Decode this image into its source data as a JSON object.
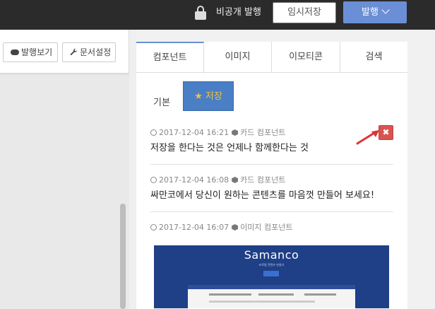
{
  "topbar": {
    "private_label": "비공개 발행",
    "draft_label": "임시저장",
    "publish_label": "발행",
    "lock_icon": "lock-icon",
    "chevron_icon": "chevron-down-icon"
  },
  "left": {
    "preview_label": "발행보기",
    "settings_label": "문서설정",
    "preview_icon": "cloud-icon",
    "settings_icon": "wrench-icon"
  },
  "tabs": [
    {
      "label": "컴포넌트",
      "active": true
    },
    {
      "label": "이미지",
      "active": false
    },
    {
      "label": "이모티콘",
      "active": false
    },
    {
      "label": "검색",
      "active": false
    }
  ],
  "subtabs": {
    "basic_label": "기본",
    "saved_label": "저장"
  },
  "items": [
    {
      "date": "2017-12-04 16:21",
      "type": "카드 컴포넌트",
      "text": "저장을 한다는 것은 언제나 함께한다는 것"
    },
    {
      "date": "2017-12-04 16:08",
      "type": "카드 컴포넌트",
      "text": "싸만코에서 당신이 원하는 콘텐츠를 마음껏 만들어 보세요!"
    },
    {
      "date": "2017-12-04 16:07",
      "type": "이미지 컴포넌트",
      "text": ""
    }
  ],
  "thumbnail": {
    "title": "Samanco",
    "subtitle": "프로필 콘텐츠 만들기"
  },
  "colors": {
    "accent": "#6a8fd6",
    "saved_tab": "#4a7fc6",
    "delete": "#d9534f",
    "topbar": "#2b2b2b"
  }
}
